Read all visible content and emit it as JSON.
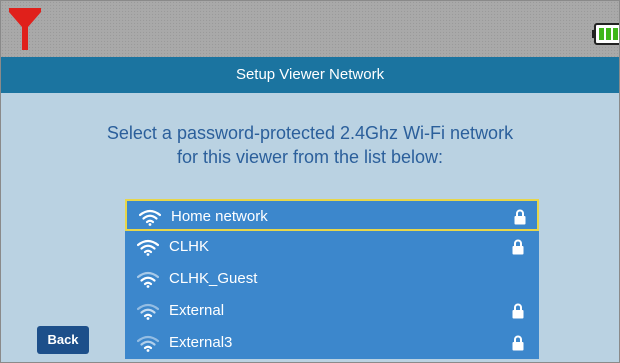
{
  "status_bar": {
    "signal_icon": "signal-strength-icon",
    "battery_icon": "battery-icon",
    "signal_color": "#e0201b",
    "battery_color": "#3fb61a"
  },
  "header": {
    "title": "Setup Viewer Network"
  },
  "main": {
    "instruction_line1": "Select a password-protected 2.4Ghz Wi-Fi network",
    "instruction_line2": "for this viewer from the list below:"
  },
  "networks": [
    {
      "name": "Home network",
      "locked": true,
      "selected": true
    },
    {
      "name": "CLHK",
      "locked": true,
      "selected": false
    },
    {
      "name": "CLHK_Guest",
      "locked": false,
      "selected": false
    },
    {
      "name": "External",
      "locked": true,
      "selected": false
    },
    {
      "name": "External3",
      "locked": true,
      "selected": false
    }
  ],
  "footer": {
    "back_label": "Back"
  },
  "colors": {
    "title_bar": "#1b74a0",
    "content_bg": "#bad2e2",
    "list_bg": "#3c87cc",
    "selection_border": "#e7d64a",
    "instruction_text": "#2b5f9b",
    "back_button": "#1d4f8a"
  }
}
